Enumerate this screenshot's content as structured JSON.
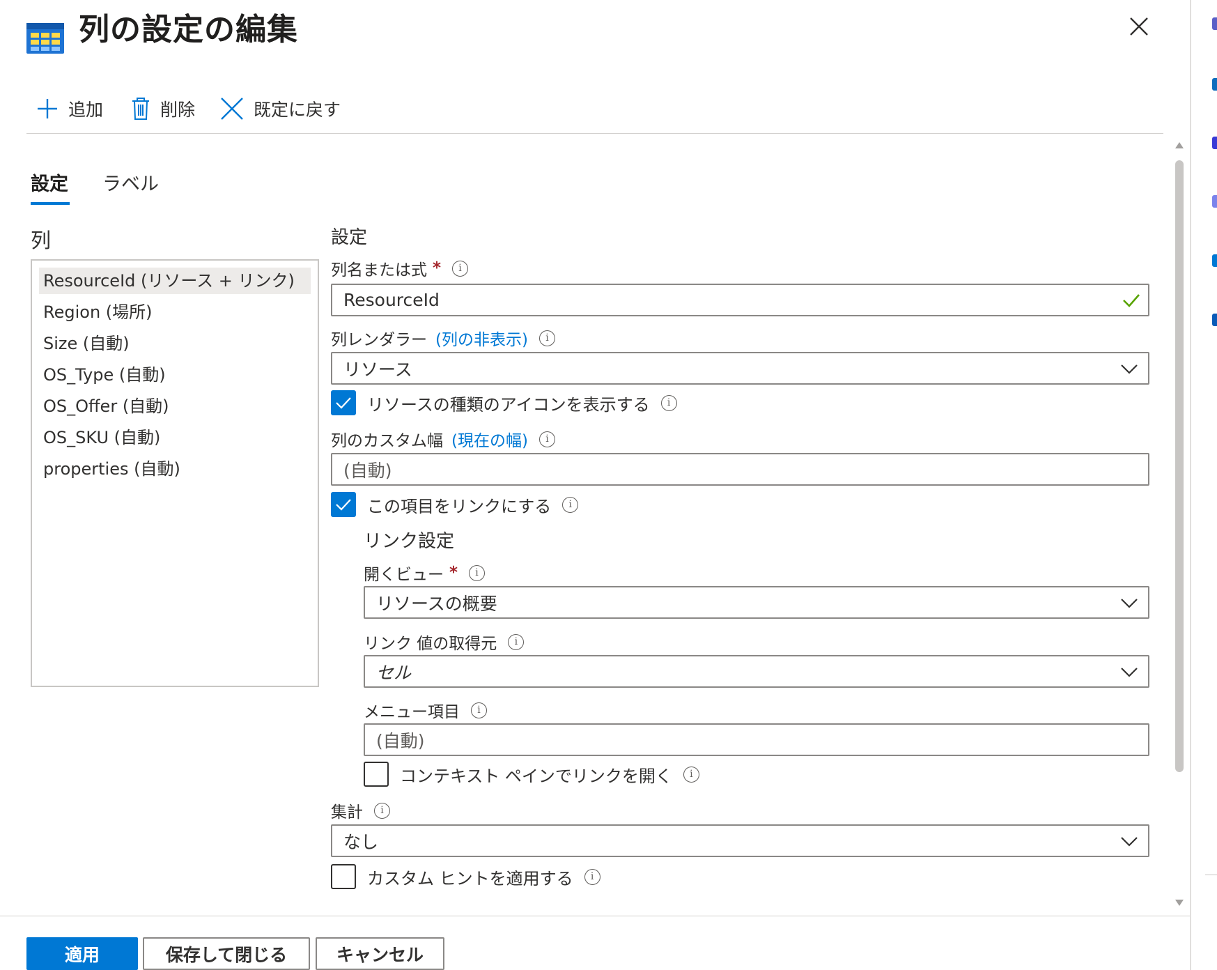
{
  "header": {
    "title": "列の設定の編集"
  },
  "toolbar": {
    "add_label": "追加",
    "delete_label": "削除",
    "reset_label": "既定に戻す"
  },
  "tabs": [
    {
      "label": "設定"
    },
    {
      "label": "ラベル"
    }
  ],
  "columns": {
    "heading": "列",
    "items": [
      "ResourceId (リソース + リンク)",
      "Region (場所)",
      "Size (自動)",
      "OS_Type (自動)",
      "OS_Offer (自動)",
      "OS_SKU (自動)",
      "properties (自動)"
    ],
    "selected_index": 0
  },
  "settings": {
    "heading": "設定",
    "column_name": {
      "label": "列名または式",
      "required_mark": "*",
      "value": "ResourceId"
    },
    "renderer": {
      "label": "列レンダラー",
      "link": "(列の非表示)",
      "value": "リソース"
    },
    "show_icon": {
      "label": "リソースの種類のアイコンを表示する",
      "checked": true
    },
    "custom_width": {
      "label": "列のカスタム幅",
      "link": "(現在の幅)",
      "placeholder": "(自動)"
    },
    "make_link": {
      "label": "この項目をリンクにする",
      "checked": true
    },
    "link_settings": {
      "heading": "リンク設定",
      "open_view": {
        "label": "開くビュー",
        "required_mark": "*",
        "value": "リソースの概要"
      },
      "link_value_from": {
        "label": "リンク 値の取得元",
        "value": "セル"
      },
      "menu_item": {
        "label": "メニュー項目",
        "placeholder": "(自動)"
      },
      "context_pane": {
        "label": "コンテキスト ペインでリンクを開く",
        "checked": false
      }
    },
    "aggregation": {
      "label": "集計",
      "value": "なし"
    },
    "custom_hint": {
      "label": "カスタム ヒントを適用する",
      "checked": false
    }
  },
  "footer": {
    "apply_label": "適用",
    "save_close_label": "保存して閉じる",
    "cancel_label": "キャンセル"
  },
  "colors": {
    "accent": "#0078d4",
    "required": "#a4262c",
    "valid": "#57a300"
  }
}
